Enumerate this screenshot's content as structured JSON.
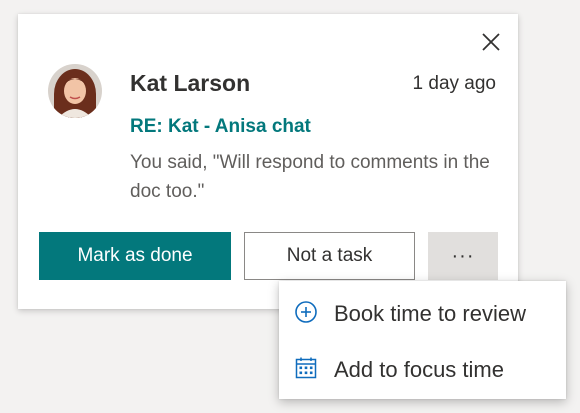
{
  "notification": {
    "sender": "Kat Larson",
    "time": "1 day ago",
    "subject": "RE: Kat - Anisa chat",
    "preview": "You said, \"Will respond to comments in the doc too.\"",
    "actions": {
      "done_label": "Mark as done",
      "not_task_label": "Not a task",
      "more_label": "···"
    }
  },
  "menu": {
    "items": [
      {
        "label": "Book time to review",
        "icon": "add-circle-icon"
      },
      {
        "label": "Add to focus time",
        "icon": "calendar-icon"
      }
    ]
  },
  "colors": {
    "accent": "#03787c",
    "icon_blue": "#0f6cbd",
    "text": "#323130",
    "secondary_text": "#605e5c",
    "more_button_bg": "#e1dfdd"
  }
}
